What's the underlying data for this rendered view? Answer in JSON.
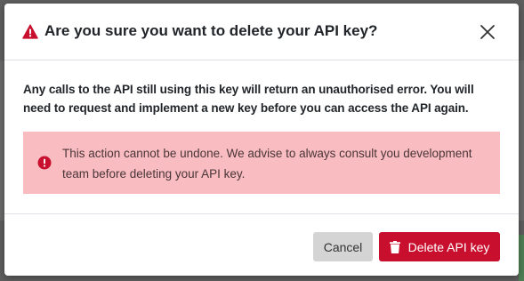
{
  "dialog": {
    "title": "Are you sure you want to delete your API key?",
    "body": "Any calls to the API still using this key will return an unauthorised error. You will need to request and implement a new key before you can access the API again.",
    "alert": "This action cannot be undone. We advise to always consult you development team before deleting your API key.",
    "cancel_label": "Cancel",
    "delete_label": "Delete API key"
  },
  "icons": {
    "title_icon": "warning-triangle-icon",
    "close_icon": "close-icon",
    "alert_icon": "exclamation-circle-icon",
    "delete_icon": "trash-icon"
  },
  "colors": {
    "danger": "#c8102e",
    "alert_background": "#f8bcc1",
    "cancel_background": "#d4d4d4"
  }
}
